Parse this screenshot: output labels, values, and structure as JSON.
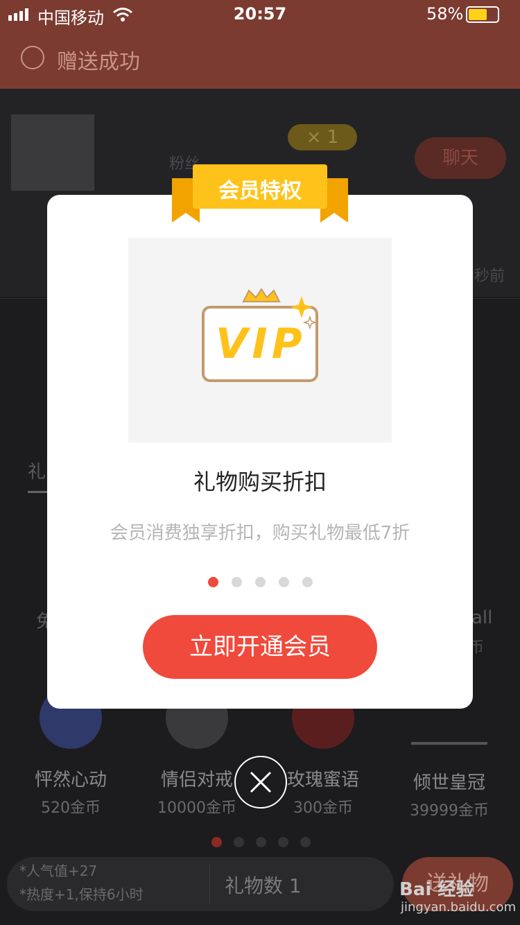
{
  "status_bar": {
    "carrier": "中国移动",
    "time": "20:57",
    "battery": "58%"
  },
  "toast": {
    "text": "赠送成功"
  },
  "background": {
    "fans_label": "粉丝",
    "multiplier": "× 1",
    "chat_label": "聊天",
    "time_ago": "秒前",
    "tab_label": "礼",
    "gifts_row1": [
      {
        "name": "免"
      },
      {
        "name": "all",
        "price": "币"
      }
    ],
    "gifts_row2": [
      {
        "name": "怦然心动",
        "price": "520金币"
      },
      {
        "name": "情侣对戒",
        "price": "10000金币"
      },
      {
        "name": "玫瑰蜜语",
        "price": "300金币"
      },
      {
        "name": "倾世皇冠",
        "price": "39999金币"
      }
    ],
    "bottom_note_1": "*人气值+27",
    "bottom_note_2": "*热度+1,保持6小时",
    "gift_count": "礼物数 1",
    "send_label": "送礼物",
    "watermark": "Bai 经验 jingyan.baidu.com"
  },
  "modal": {
    "banner": "会员特权",
    "vip_logo": "VIP",
    "title": "礼物购买折扣",
    "description": "会员消费独享折扣，购买礼物最低7折",
    "active_dot": 0,
    "dot_count": 5,
    "cta": "立即开通会员"
  },
  "colors": {
    "accent": "#f04a3c",
    "banner": "#ffc21a",
    "header": "#7c3b30"
  },
  "icons": [
    "signal-icon",
    "wifi-icon",
    "check-circle-icon",
    "close-icon",
    "vip-icon",
    "chat-icon"
  ]
}
